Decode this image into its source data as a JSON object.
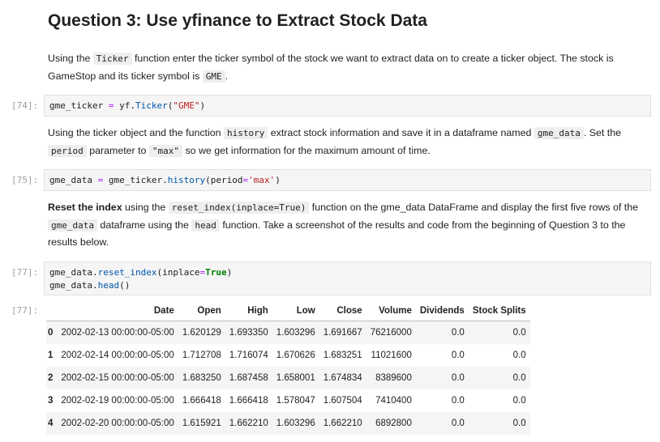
{
  "heading": "Question 3: Use yfinance to Extract Stock Data",
  "md1": {
    "t1": "Using the ",
    "c1": "Ticker",
    "t2": " function enter the ticker symbol of the stock we want to extract data on to create a ticker object. The stock is GameStop and its ticker symbol is ",
    "c2": "GME",
    "t3": "."
  },
  "cell74": {
    "prompt": "[74]:",
    "p1": "gme_ticker ",
    "p2": "=",
    "p3": " yf.",
    "p4": "Ticker",
    "p5": "(",
    "p6": "\"GME\"",
    "p7": ")"
  },
  "md2": {
    "t1": "Using the ticker object and the function ",
    "c1": "history",
    "t2": " extract stock information and save it in a dataframe named ",
    "c2": "gme_data",
    "t3": ". Set the ",
    "c3": "period",
    "t4": " parameter to ",
    "c4": "\"max\"",
    "t5": " so we get information for the maximum amount of time."
  },
  "cell75": {
    "prompt": "[75]:",
    "p1": "gme_data ",
    "p2": "=",
    "p3": " gme_ticker.",
    "p4": "history",
    "p5": "(period",
    "p6": "=",
    "p7": "'max'",
    "p8": ")"
  },
  "md3": {
    "b1": "Reset the index",
    "t1": " using the ",
    "c1": "reset_index(inplace=True)",
    "t2": " function on the gme_data DataFrame and display the first five rows of the ",
    "c2": "gme_data",
    "t3": " dataframe using the ",
    "c3": "head",
    "t4": " function. Take a screenshot of the results and code from the beginning of Question 3 to the results below."
  },
  "cell77": {
    "prompt": "[77]:",
    "l1a": "gme_data.",
    "l1b": "reset_index",
    "l1c": "(inplace",
    "l1d": "=",
    "l1e": "True",
    "l1f": ")",
    "l2a": "gme_data.",
    "l2b": "head",
    "l2c": "()"
  },
  "output77": {
    "prompt": "[77]:",
    "columns": [
      "",
      "Date",
      "Open",
      "High",
      "Low",
      "Close",
      "Volume",
      "Dividends",
      "Stock Splits"
    ],
    "rows": [
      [
        "0",
        "2002-02-13 00:00:00-05:00",
        "1.620129",
        "1.693350",
        "1.603296",
        "1.691667",
        "76216000",
        "0.0",
        "0.0"
      ],
      [
        "1",
        "2002-02-14 00:00:00-05:00",
        "1.712708",
        "1.716074",
        "1.670626",
        "1.683251",
        "11021600",
        "0.0",
        "0.0"
      ],
      [
        "2",
        "2002-02-15 00:00:00-05:00",
        "1.683250",
        "1.687458",
        "1.658001",
        "1.674834",
        "8389600",
        "0.0",
        "0.0"
      ],
      [
        "3",
        "2002-02-19 00:00:00-05:00",
        "1.666418",
        "1.666418",
        "1.578047",
        "1.607504",
        "7410400",
        "0.0",
        "0.0"
      ],
      [
        "4",
        "2002-02-20 00:00:00-05:00",
        "1.615921",
        "1.662210",
        "1.603296",
        "1.662210",
        "6892800",
        "0.0",
        "0.0"
      ]
    ]
  }
}
